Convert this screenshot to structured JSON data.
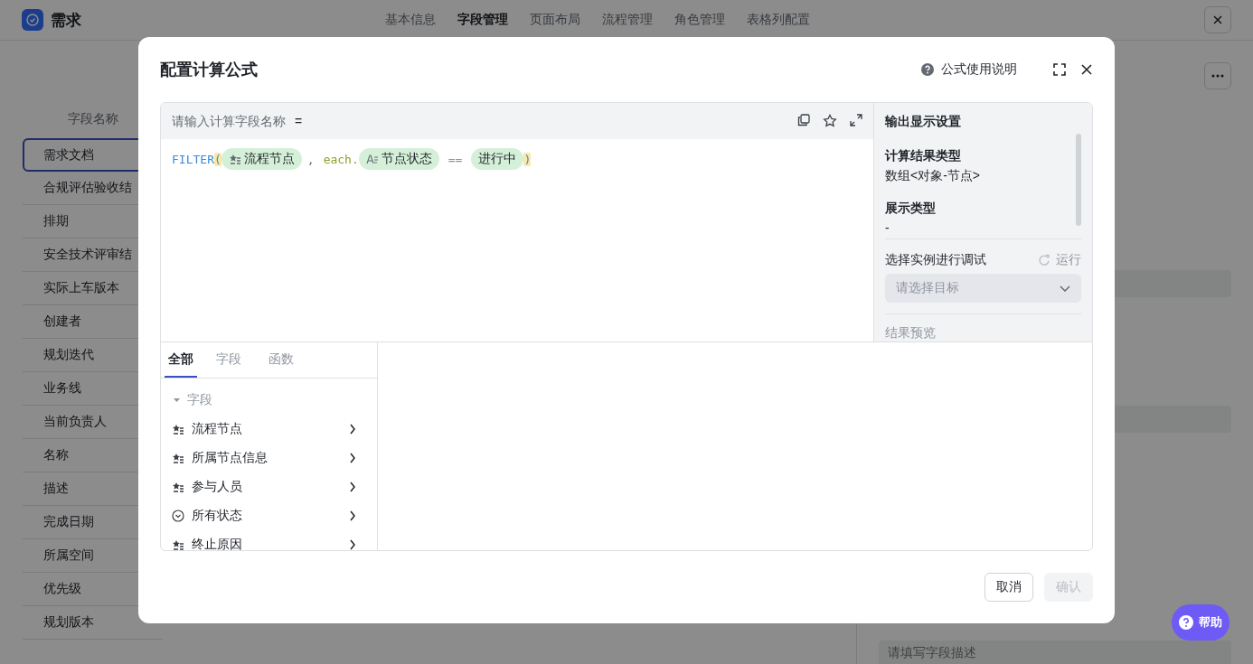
{
  "app": {
    "title": "需求",
    "tabs": [
      {
        "label": "基本信息",
        "selected": false
      },
      {
        "label": "字段管理",
        "selected": true
      },
      {
        "label": "页面布局",
        "selected": false
      },
      {
        "label": "流程管理",
        "selected": false
      },
      {
        "label": "角色管理",
        "selected": false
      },
      {
        "label": "表格列配置",
        "selected": false
      }
    ]
  },
  "field_list": {
    "header": "字段名称",
    "items": [
      {
        "label": "需求文档",
        "selected": true
      },
      {
        "label": "合规评估验收结",
        "selected": false
      },
      {
        "label": "排期",
        "selected": false
      },
      {
        "label": "安全技术评审结",
        "selected": false
      },
      {
        "label": "实际上车版本",
        "selected": false
      },
      {
        "label": "创建者",
        "selected": false
      },
      {
        "label": "规划迭代",
        "selected": false
      },
      {
        "label": "业务线",
        "selected": false
      },
      {
        "label": "当前负责人",
        "selected": false
      },
      {
        "label": "名称",
        "selected": false
      },
      {
        "label": "描述",
        "selected": false
      },
      {
        "label": "完成日期",
        "selected": false
      },
      {
        "label": "所属空间",
        "selected": false
      },
      {
        "label": "优先级",
        "selected": false
      },
      {
        "label": "规划版本",
        "selected": false
      }
    ]
  },
  "detail_panel": {
    "description_placeholder": "请填写字段描述"
  },
  "dialog": {
    "title": "配置计算公式",
    "help_link": "公式使用说明",
    "name_field": {
      "placeholder": "请输入计算字段名称"
    },
    "equals": "=",
    "formula": [
      {
        "kind": "func",
        "text": "FILTER"
      },
      {
        "kind": "bracket",
        "text": "("
      },
      {
        "kind": "node-field",
        "text": "流程节点"
      },
      {
        "kind": "punct",
        "text": ","
      },
      {
        "kind": "keyword",
        "text": "each."
      },
      {
        "kind": "text-field",
        "text": "节点状态"
      },
      {
        "kind": "op",
        "text": "=="
      },
      {
        "kind": "value",
        "text": "进行中"
      },
      {
        "kind": "bracket",
        "text": ")"
      }
    ],
    "output": {
      "title": "输出显示设置",
      "sections": [
        {
          "label": "计算结果类型",
          "value": "数组<对象-节点>"
        },
        {
          "label": "展示类型",
          "value": "-"
        }
      ],
      "debug_label": "选择实例进行调试",
      "run": "运行",
      "target_placeholder": "请选择目标",
      "preview_label": "结果预览"
    },
    "picker": {
      "tabs": [
        {
          "label": "全部",
          "selected": true
        },
        {
          "label": "字段",
          "selected": false
        },
        {
          "label": "函数",
          "selected": false
        }
      ],
      "groups": [
        {
          "label": "字段",
          "expanded": true,
          "children": [
            {
              "label": "流程节点",
              "kind": "node"
            },
            {
              "label": "所属节点信息",
              "kind": "node"
            },
            {
              "label": "参与人员",
              "kind": "node"
            },
            {
              "label": "所有状态",
              "kind": "status"
            },
            {
              "label": "终止原因",
              "kind": "node"
            }
          ]
        }
      ]
    },
    "buttons": [
      {
        "label": "取消",
        "disabled": false
      },
      {
        "label": "确认",
        "disabled": true
      }
    ]
  },
  "help_button": {
    "label": "帮助"
  }
}
